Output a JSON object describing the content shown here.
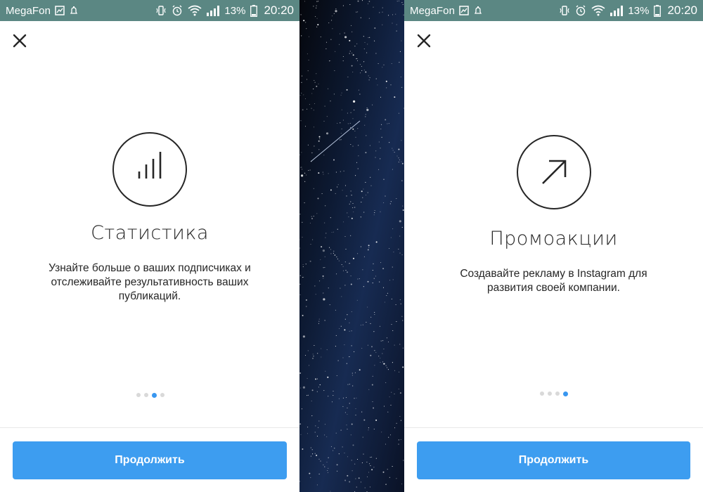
{
  "status_bar": {
    "carrier": "MegaFon",
    "battery": "13%",
    "time": "20:20"
  },
  "screens": [
    {
      "icon": "bar-chart-icon",
      "title": "Статистика",
      "description_lines": [
        "Узнайте больше о ваших подписчиках и",
        "отслеживайте результативность ваших",
        "публикаций."
      ],
      "pagination": {
        "total": 4,
        "active": 3
      },
      "button_label": "Продолжить"
    },
    {
      "icon": "arrow-up-right-icon",
      "title": "Промоакции",
      "description_lines": [
        "Создавайте рекламу в Instagram для",
        "развития своей компании."
      ],
      "pagination": {
        "total": 4,
        "active": 4
      },
      "button_label": "Продолжить"
    }
  ],
  "colors": {
    "status_bar": "#5b8783",
    "button": "#3d9df0",
    "active_dot": "#3897f0",
    "inactive_dot": "#d9d9d9",
    "text": "#262626"
  }
}
